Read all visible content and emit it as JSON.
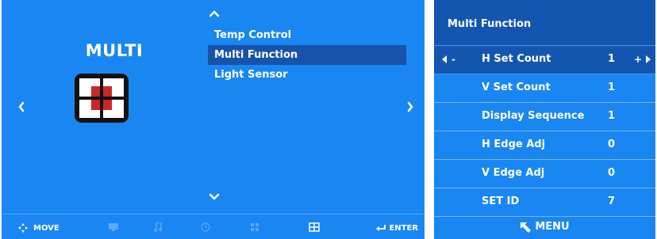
{
  "left_panel": {
    "category_title": "MULTI",
    "menu_items": [
      {
        "label": "Temp Control",
        "selected": false
      },
      {
        "label": "Multi Function",
        "selected": true
      },
      {
        "label": "Light Sensor",
        "selected": false
      }
    ],
    "bottom_bar": {
      "move_label": "MOVE",
      "enter_label": "ENTER",
      "category_icons": [
        "monitor-icon",
        "music-icon",
        "clock-icon",
        "grid-icon",
        "multi-icon"
      ],
      "active_category": "multi-icon"
    }
  },
  "right_panel": {
    "title": "Multi Function",
    "rows": [
      {
        "name": "H Set Count",
        "value": "1",
        "selected": true,
        "dec_label": "-",
        "inc_label": "+"
      },
      {
        "name": "V Set Count",
        "value": "1",
        "selected": false
      },
      {
        "name": "Display Sequence",
        "value": "1",
        "selected": false
      },
      {
        "name": "H Edge Adj",
        "value": "0",
        "selected": false
      },
      {
        "name": "V Edge Adj",
        "value": "0",
        "selected": false
      },
      {
        "name": "SET ID",
        "value": "7",
        "selected": false
      }
    ],
    "footer_label": "MENU"
  },
  "colors": {
    "osd_background": "#1a86f1",
    "selection_background": "#1356b0",
    "inactive_icon": "#5ea9f3",
    "icon_red": "#c62828"
  }
}
